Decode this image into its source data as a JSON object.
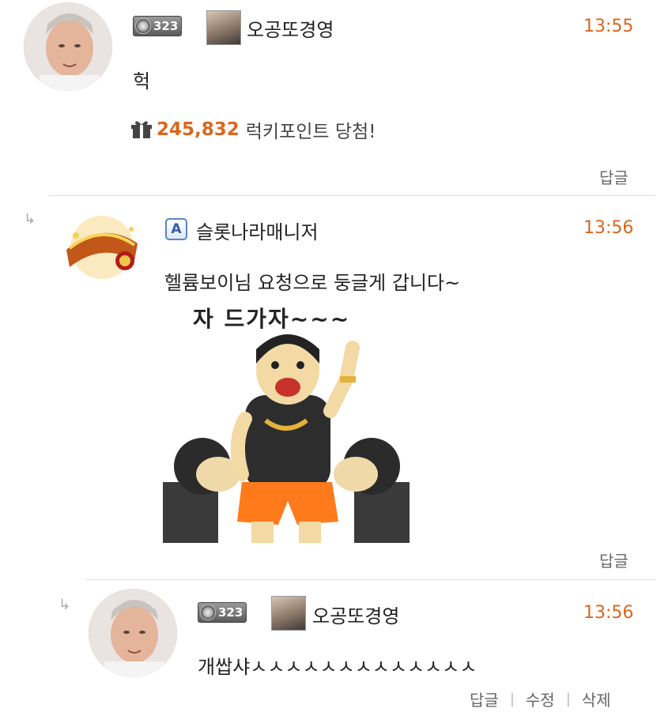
{
  "comments": [
    {
      "level": "323",
      "nickname": "오공또경영",
      "time": "13:55",
      "message": "헉",
      "lucky": {
        "amount": "245,832",
        "text": "럭키포인트 당첨!"
      },
      "actions": [
        "답글"
      ]
    },
    {
      "nickname": "슬롯나라매니저",
      "time": "13:56",
      "message": "헬륨보이님 요청으로 둥글게 갑니다~",
      "sticker_text": "자 드가자~~~",
      "actions": [
        "답글"
      ]
    },
    {
      "level": "323",
      "nickname": "오공또경영",
      "time": "13:56",
      "message": "개쌉샤ㅅㅅㅅㅅㅅㅅㅅㅅㅅㅅㅅㅅㅅ",
      "actions": [
        "답글",
        "수정",
        "삭제"
      ]
    }
  ],
  "colors": {
    "accent": "#d8671f",
    "divider": "#dddddd",
    "admin_blue": "#2f5fa8"
  },
  "icons": [
    "gift-icon",
    "reply-arrow-icon",
    "admin-badge-icon",
    "level-badge-icon"
  ]
}
